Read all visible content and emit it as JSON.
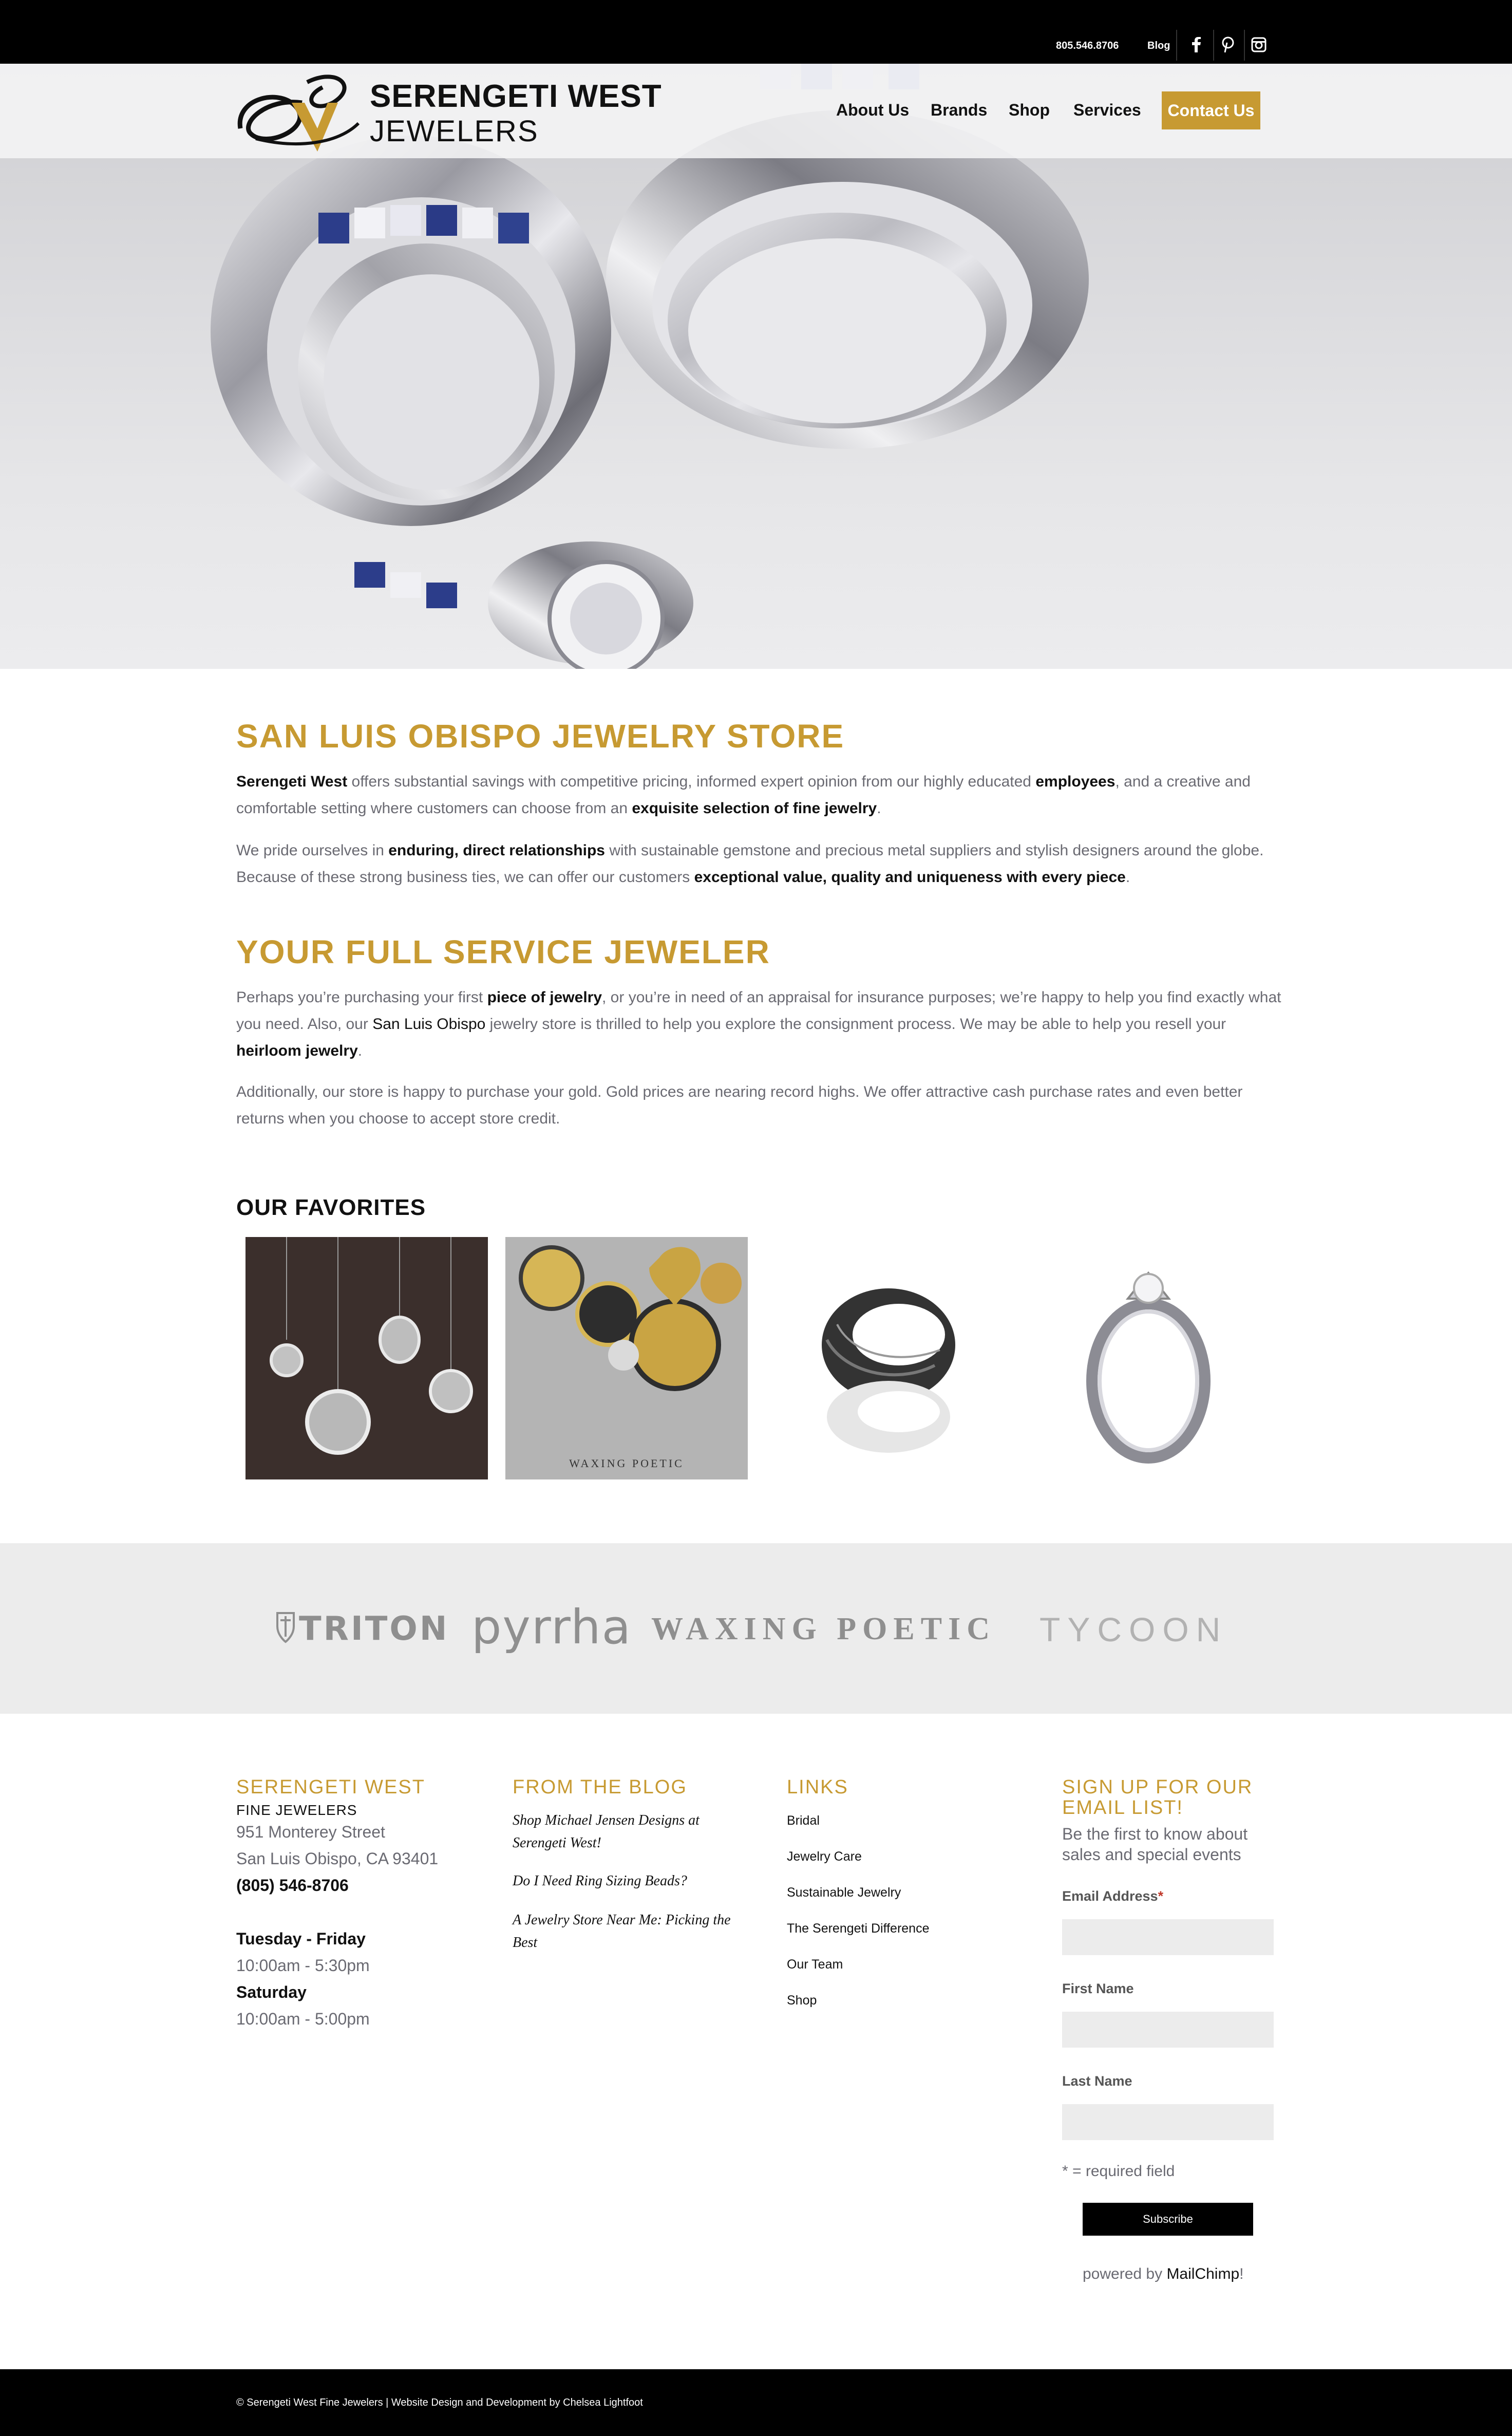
{
  "topbar": {
    "phone": "805.546.8706",
    "blog": "Blog",
    "social": [
      "facebook-icon",
      "pinterest-icon",
      "instagram-icon"
    ]
  },
  "header": {
    "logo_line1": "SERENGETI WEST",
    "logo_line2": "JEWELERS",
    "nav": [
      "About Us",
      "Brands",
      "Shop",
      "Services"
    ],
    "contact": "Contact Us"
  },
  "content": {
    "h1": "SAN LUIS OBISPO JEWELRY STORE",
    "p1": [
      "Serengeti West",
      " offers substantial savings with competitive pricing, informed expert opinion from our highly educated ",
      "employees",
      ", and a creative and comfortable setting where customers can choose from an ",
      "exquisite selection of fine jewelry",
      "."
    ],
    "p2": [
      "We pride ourselves in ",
      "enduring, direct relationships",
      " with sustainable gemstone and precious metal suppliers and stylish designers around the globe. Because of these strong business ties, we can offer our customers ",
      "exceptional value, quality and uniqueness with every piece",
      "."
    ],
    "h2": "YOUR FULL SERVICE JEWELER",
    "p3": [
      "Perhaps you’re purchasing your first ",
      "piece of jewelry",
      ", or you’re in need of an appraisal for insurance purposes; we’re happy to help you find exactly what you need. Also, our ",
      "San Luis Obispo",
      " jewelry store is thrilled to help you explore the consignment process. We may be able to help you resell your ",
      "heirloom jewelry",
      "."
    ],
    "p4": "Additionally, our store is happy to purchase your gold. Gold prices are nearing record highs. We offer attractive cash purchase rates and even better returns when you choose to accept store credit.",
    "favorites_title": "OUR FAVORITES",
    "waxing_caption": "WAXING POETIC"
  },
  "brands": [
    "TRITON",
    "pyrrha",
    "WAXING POETIC",
    "TYCOON"
  ],
  "footer": {
    "col1": {
      "title": "SERENGETI WEST",
      "subtitle": "FINE JEWELERS",
      "address1": "951 Monterey Street",
      "address2": "San Luis Obispo, CA 93401",
      "phone": "(805) 546-8706",
      "days1": "Tuesday - Friday",
      "hours1": "10:00am - 5:30pm",
      "days2": "Saturday",
      "hours2": "10:00am - 5:00pm"
    },
    "col2": {
      "title": "FROM THE BLOG",
      "posts": [
        "Shop Michael Jensen Designs at Serengeti West!",
        "Do I Need Ring Sizing Beads?",
        "A Jewelry Store Near Me: Picking the Best"
      ]
    },
    "col3": {
      "title": "LINKS",
      "links": [
        "Bridal",
        "Jewelry Care",
        "Sustainable Jewelry",
        "The Serengeti Difference",
        "Our Team",
        "Shop"
      ]
    },
    "col4": {
      "title_line1": "SIGN UP FOR OUR",
      "title_line2": "EMAIL LIST!",
      "desc_line1": "Be the first to know about",
      "desc_line2": "sales and special events",
      "email_label": "Email Address",
      "required_mark": "*",
      "first_label": "First Name",
      "last_label": "Last Name",
      "required_note": "* = required field",
      "subscribe": "Subscribe",
      "powered_prefix": "powered by ",
      "powered_brand": "MailChimp",
      "powered_suffix": "!"
    }
  },
  "copyright": "© Serengeti West Fine Jewelers | Website Design and Development by Chelsea Lightfoot",
  "colors": {
    "gold": "#c79a32",
    "black": "#000000",
    "text": "#6a6a72"
  }
}
